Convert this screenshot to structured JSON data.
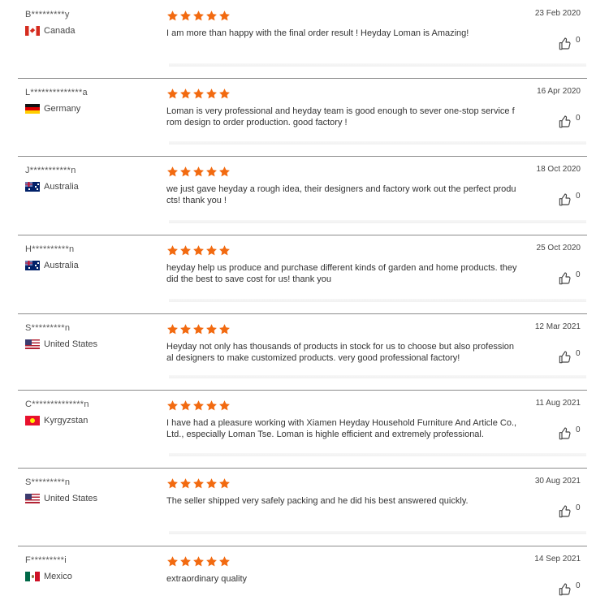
{
  "colors": {
    "star": "#f26a10",
    "divider": "#8c8c8c"
  },
  "reviews": [
    {
      "name": "B*********y",
      "country": "Canada",
      "flag": "flag-ca",
      "rating": 5,
      "date": "23 Feb 2020",
      "text": "I am more than happy with the final order result ! Heyday Loman is Amazing!",
      "likes": "0"
    },
    {
      "name": "L**************a",
      "country": "Germany",
      "flag": "flag-de",
      "rating": 5,
      "date": "16 Apr 2020",
      "text": "Loman is very professional and heyday team is good enough to sever one-stop service from design to order production.  good factory !",
      "likes": "0"
    },
    {
      "name": "J***********n",
      "country": "Australia",
      "flag": "flag-au",
      "rating": 5,
      "date": "18 Oct 2020",
      "text": "we just gave heyday a rough idea, their designers and factory work out the perfect products!  thank you !",
      "likes": "0"
    },
    {
      "name": "H**********n",
      "country": "Australia",
      "flag": "flag-au",
      "rating": 5,
      "date": "25 Oct 2020",
      "text": "heyday help us produce and  purchase different kinds of garden and home products. they did the best to save cost for us!  thank you",
      "likes": "0"
    },
    {
      "name": "S*********n",
      "country": "United States",
      "flag": "flag-us",
      "rating": 5,
      "date": "12 Mar 2021",
      "text": "Heyday not only has thousands of products in stock for us to choose but also professional designers to make customized products.  very good professional factory!",
      "likes": "0"
    },
    {
      "name": "C**************n",
      "country": "Kyrgyzstan",
      "flag": "flag-kg",
      "rating": 5,
      "date": "11 Aug 2021",
      "text": "I have had a pleasure working with Xiamen Heyday Household Furniture And Article Co., Ltd., especially Loman Tse. Loman is highle efficient and extremely professional.",
      "likes": "0"
    },
    {
      "name": "S*********n",
      "country": "United States",
      "flag": "flag-us",
      "rating": 5,
      "date": "30 Aug 2021",
      "text": "The seller shipped very safely packing and he did his best answered quickly.",
      "likes": "0"
    },
    {
      "name": "F*********i",
      "country": "Mexico",
      "flag": "flag-mx",
      "rating": 5,
      "date": "14 Sep 2021",
      "text": "extraordinary quality",
      "likes": "0"
    }
  ]
}
